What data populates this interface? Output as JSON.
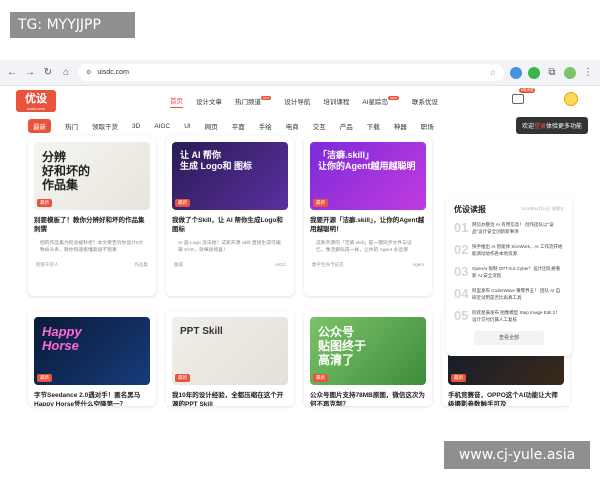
{
  "watermark_top": "TG: MYYJJPP",
  "watermark_bottom": "www.cj-yule.asia",
  "browser": {
    "url": "uisdc.com"
  },
  "site": {
    "logo_main": "优设",
    "logo_sub": "uisdc.com",
    "nav": [
      {
        "label": "首页",
        "active": true
      },
      {
        "label": "设计文章"
      },
      {
        "label": "热门频道",
        "badge": "HOT"
      },
      {
        "label": "设计导航"
      },
      {
        "label": "培训课程"
      },
      {
        "label": "AI星踪岛",
        "badge": "NEW"
      },
      {
        "label": "联系优设"
      }
    ],
    "msg_badge": "6条消息"
  },
  "subnav": {
    "items": [
      "最新",
      "热门",
      "领取干货",
      "3D",
      "AIGC",
      "UI",
      "网页",
      "平面",
      "手绘",
      "电商",
      "交互",
      "产品",
      "下载",
      "神器",
      "职场"
    ],
    "tooltip_prefix": "欢迎",
    "tooltip_em": "登录",
    "tooltip_suffix": "体验更多功能"
  },
  "cards": [
    {
      "thumb_text": "分辨\n好和坏的\n作品集",
      "tag": "最新",
      "title": "别要模板了！教你分辨好和坏的作品集刺猬",
      "desc": "招的作品集为何总被秒拒？本文要告诉你设计5大致命头条，教你快速看懂高级不错事",
      "author": "新锐干货人",
      "category": "作品集"
    },
    {
      "thumb_text": "让 AI 帮你\n生成 Logo和 图标",
      "tag": "最新",
      "title": "我做了个Skill，让 AI 帮你生成Logo和图标",
      "desc": "AI 画 Logo 没法搞？试新开源 Skill 直接生成可编辑 SVG，效果很惊喜！",
      "author": "独孤",
      "category": "AIGC"
    },
    {
      "thumb_text": "「洁癖.skill」\n让你的Agent越用越聪明",
      "tag": "最新",
      "title": "我要开源「洁癖.skill」，让你的Agent越用越聪明！",
      "desc": "这款开源的「洁癖.skill」是一键同步文件与记忆，像洁癖似得一样，让你的 Agent 永远保",
      "author": "数字生命卡兹克",
      "category": "Agent"
    },
    {
      "thumb_text": "Happy\nHorse",
      "tag": "最新",
      "title": "字节Seedance 2.0遇对手！匿名黑马Happy Horse凭什么空降第一？",
      "desc": "",
      "author": "",
      "category": ""
    },
    {
      "thumb_text": "PPT Skill",
      "tag": "最新",
      "title": "我10年的设计经验，全都压缩在这个开源的PPT Skill",
      "desc": "",
      "author": "",
      "category": ""
    },
    {
      "thumb_text": "公众号\n贴图终于\n高清了",
      "tag": "最新",
      "title": "公众号图片支持78MB原图，微信这次为何不再克制？",
      "desc": "",
      "author": "",
      "category": ""
    },
    {
      "thumb_text": "参数变成\n风格资产",
      "tag": "最新",
      "title": "手机竞赛音，OPPO这个AI功能让大师级摄影参数触手可及",
      "desc": "",
      "author": "",
      "category": ""
    }
  ],
  "side": {
    "title": "优设读报",
    "date": "2026年04月10日 星期五",
    "items": [
      {
        "num": "01",
        "text": "网信办整治 AI 有用信息！ 创作团队以\"误品\"设计安全创新新事项"
      },
      {
        "num": "02",
        "text": "快手推出 AI 智能体 KiroWork，AI 工作流开始能调动协作各本地资源"
      },
      {
        "num": "03",
        "text": "OpenAI 限制 GPT-5.5 Cyber！设计团队要看新 AI 安全流程"
      },
      {
        "num": "04",
        "text": "阿里发布 CoderWave 赚零界五！ 团队 AI 自研近试用是否比再真工具"
      },
      {
        "num": "05",
        "text": "阶跃星辰发布 图像模型 Step Image Edit 2！设计交付仍属人工复核"
      }
    ],
    "more": "查看全部"
  },
  "colors": {
    "accent": "#e9533c"
  }
}
